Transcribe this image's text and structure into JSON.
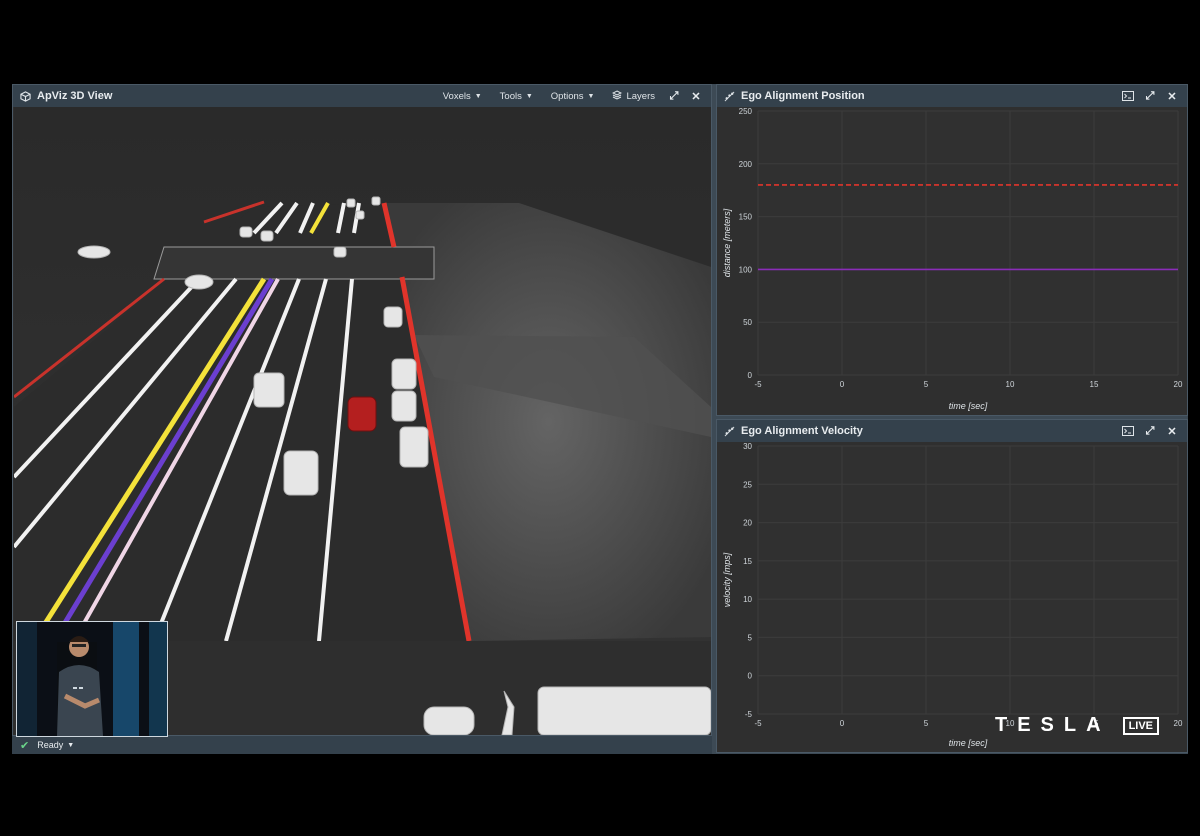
{
  "view3d": {
    "title": "ApViz 3D View",
    "buttons": {
      "voxels": "Voxels",
      "tools": "Tools",
      "options": "Options",
      "layers": "Layers"
    }
  },
  "status": {
    "text": "Ready"
  },
  "position_plot": {
    "title": "Ego Alignment Position",
    "chart_data": {
      "type": "line",
      "xlabel": "time [sec]",
      "ylabel": "distance [meters]",
      "xlim": [
        -5,
        20
      ],
      "ylim": [
        0,
        250
      ],
      "x_ticks": [
        "-5",
        "0",
        "5",
        "10",
        "15",
        "20"
      ],
      "y_ticks": [
        "0",
        "50",
        "100",
        "150",
        "200",
        "250"
      ],
      "series": [
        {
          "style": "dashed",
          "color": "#e0342b",
          "x": [
            -5,
            20
          ],
          "y": [
            180,
            180
          ]
        },
        {
          "style": "solid",
          "color": "#8a2db8",
          "x": [
            -5,
            20
          ],
          "y": [
            100,
            100
          ]
        }
      ],
      "grid": true
    }
  },
  "velocity_plot": {
    "title": "Ego Alignment Velocity",
    "chart_data": {
      "type": "line",
      "xlabel": "time [sec]",
      "ylabel": "velocity [mps]",
      "xlim": [
        -5,
        20
      ],
      "ylim": [
        -5,
        30
      ],
      "x_ticks": [
        "-5",
        "0",
        "5",
        "10",
        "15",
        "20"
      ],
      "y_ticks": [
        "-5",
        "0",
        "5",
        "10",
        "15",
        "20",
        "25",
        "30"
      ],
      "series": [],
      "grid": true
    }
  },
  "overlay": {
    "brand": "TESLA",
    "live_badge": "LIVE"
  },
  "colors": {
    "panel_bg": "#2f2f2f",
    "titlebar": "#34414c",
    "dashed_line": "#e0342b",
    "solid_line": "#8a2db8"
  }
}
